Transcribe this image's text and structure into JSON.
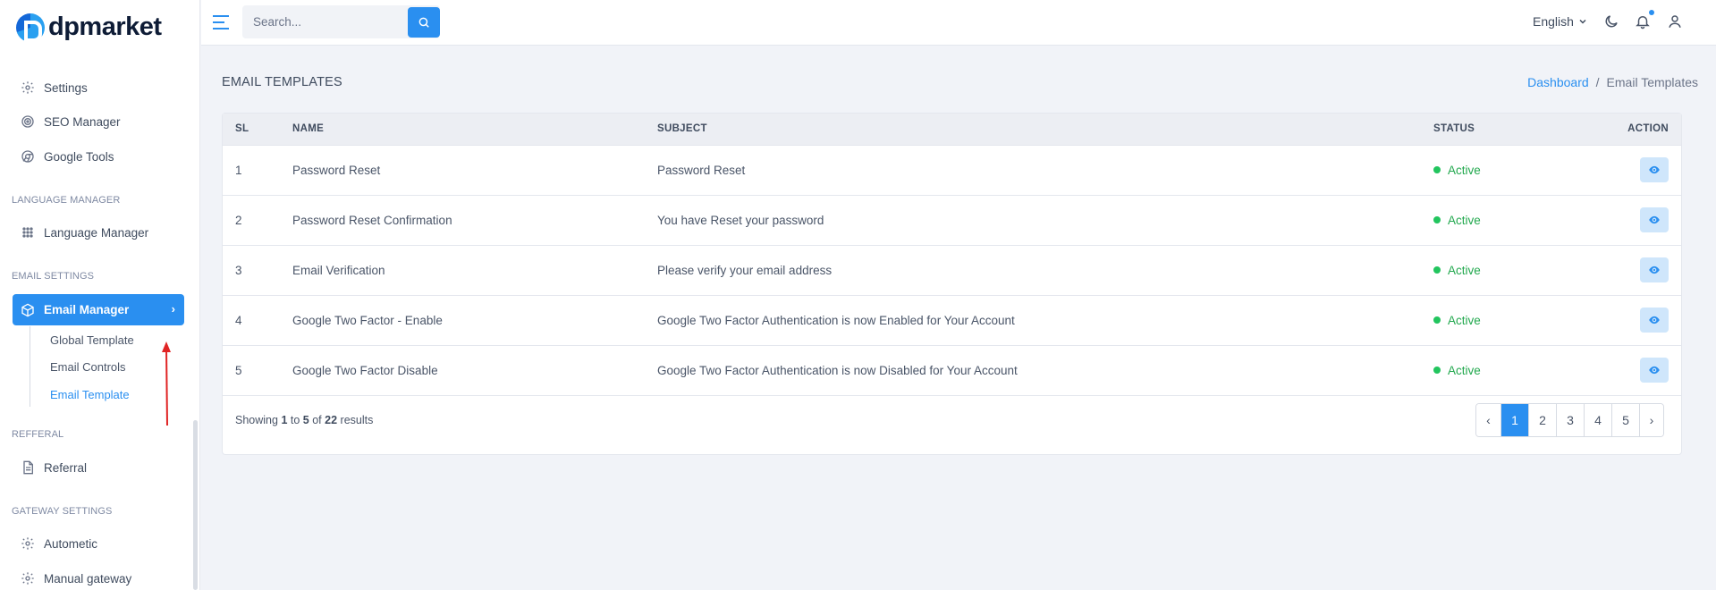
{
  "brand": {
    "name": "dpmarket"
  },
  "sidebar": {
    "items_top": [
      {
        "label": "Settings",
        "icon": "gear-icon"
      },
      {
        "label": "SEO Manager",
        "icon": "target-icon"
      },
      {
        "label": "Google Tools",
        "icon": "chrome-icon"
      }
    ],
    "section_language": "LANGUAGE MANAGER",
    "language_item": "Language Manager",
    "section_email": "EMAIL SETTINGS",
    "email_manager": "Email Manager",
    "email_sub": [
      "Global Template",
      "Email Controls",
      "Email Template"
    ],
    "section_referral": "REFFERAL",
    "referral_item": "Referral",
    "section_gateway": "GATEWAY SETTINGS",
    "gateway_items": [
      "Autometic",
      "Manual gateway"
    ]
  },
  "header": {
    "search_placeholder": "Search...",
    "language": "English"
  },
  "main": {
    "title": "EMAIL TEMPLATES",
    "breadcrumb": {
      "link": "Dashboard",
      "separator": "/",
      "current": "Email Templates"
    },
    "columns": [
      "SL",
      "NAME",
      "SUBJECT",
      "STATUS",
      "ACTION"
    ],
    "rows": [
      {
        "sl": "1",
        "name": "Password Reset",
        "subject": "Password Reset",
        "status": "Active"
      },
      {
        "sl": "2",
        "name": "Password Reset Confirmation",
        "subject": "You have Reset your password",
        "status": "Active"
      },
      {
        "sl": "3",
        "name": "Email Verification",
        "subject": "Please verify your email address",
        "status": "Active"
      },
      {
        "sl": "4",
        "name": "Google Two Factor - Enable",
        "subject": "Google Two Factor Authentication is now Enabled for Your Account",
        "status": "Active"
      },
      {
        "sl": "5",
        "name": "Google Two Factor Disable",
        "subject": "Google Two Factor Authentication is now Disabled for Your Account",
        "status": "Active"
      }
    ],
    "footer": {
      "showing": "Showing",
      "from": "1",
      "to_word": "to",
      "to": "5",
      "of_word": "of",
      "total": "22",
      "results": "results"
    },
    "pagination": {
      "prev": "‹",
      "pages": [
        "1",
        "2",
        "3",
        "4",
        "5"
      ],
      "next": "›",
      "current": "1"
    }
  },
  "colors": {
    "accent": "#2a8ff0",
    "active_status": "#22a84e"
  }
}
